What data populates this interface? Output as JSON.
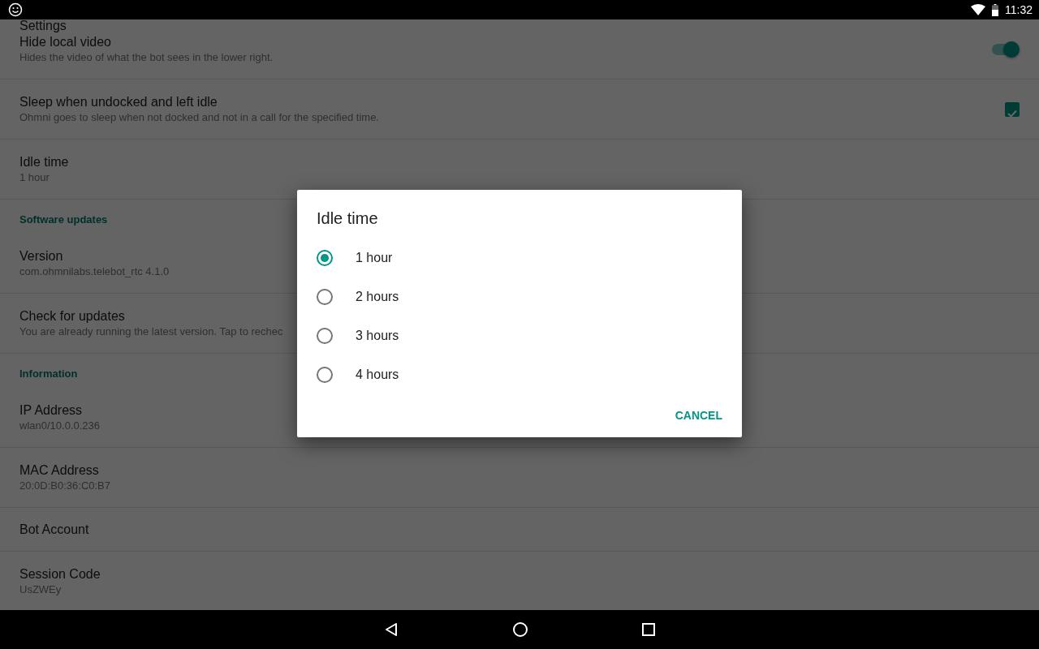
{
  "status_bar": {
    "time": "11:32"
  },
  "app_bar": {
    "title": "Settings"
  },
  "settings": [
    {
      "kind": "item",
      "title": "Hide local video",
      "summary": "Hides the video of what the bot sees in the lower right.",
      "control": {
        "kind": "switch",
        "on": true
      }
    },
    {
      "kind": "item",
      "title": "Sleep when undocked and left idle",
      "summary": "Ohmni goes to sleep when not docked and not in a call for the specified time.",
      "control": {
        "kind": "checkbox",
        "checked": true
      }
    },
    {
      "kind": "item",
      "title": "Idle time",
      "summary": "1 hour"
    },
    {
      "kind": "category",
      "title": "Software updates"
    },
    {
      "kind": "item",
      "title": "Version",
      "summary": "com.ohmnilabs.telebot_rtc 4.1.0"
    },
    {
      "kind": "item",
      "title": "Check for updates",
      "summary": "You are already running the latest version. Tap to rechec"
    },
    {
      "kind": "category",
      "title": "Information"
    },
    {
      "kind": "item",
      "title": "IP Address",
      "summary": "wlan0/10.0.0.236"
    },
    {
      "kind": "item",
      "title": "MAC Address",
      "summary": "20:0D:B0:36:C0:B7"
    },
    {
      "kind": "item",
      "title": "Bot Account"
    },
    {
      "kind": "item",
      "title": "Session Code",
      "summary": "UsZWEy"
    }
  ],
  "dialog": {
    "title": "Idle time",
    "options": [
      {
        "label": "1 hour",
        "selected": true
      },
      {
        "label": "2 hours",
        "selected": false
      },
      {
        "label": "3 hours",
        "selected": false
      },
      {
        "label": "4 hours",
        "selected": false
      }
    ],
    "button": "CANCEL"
  }
}
